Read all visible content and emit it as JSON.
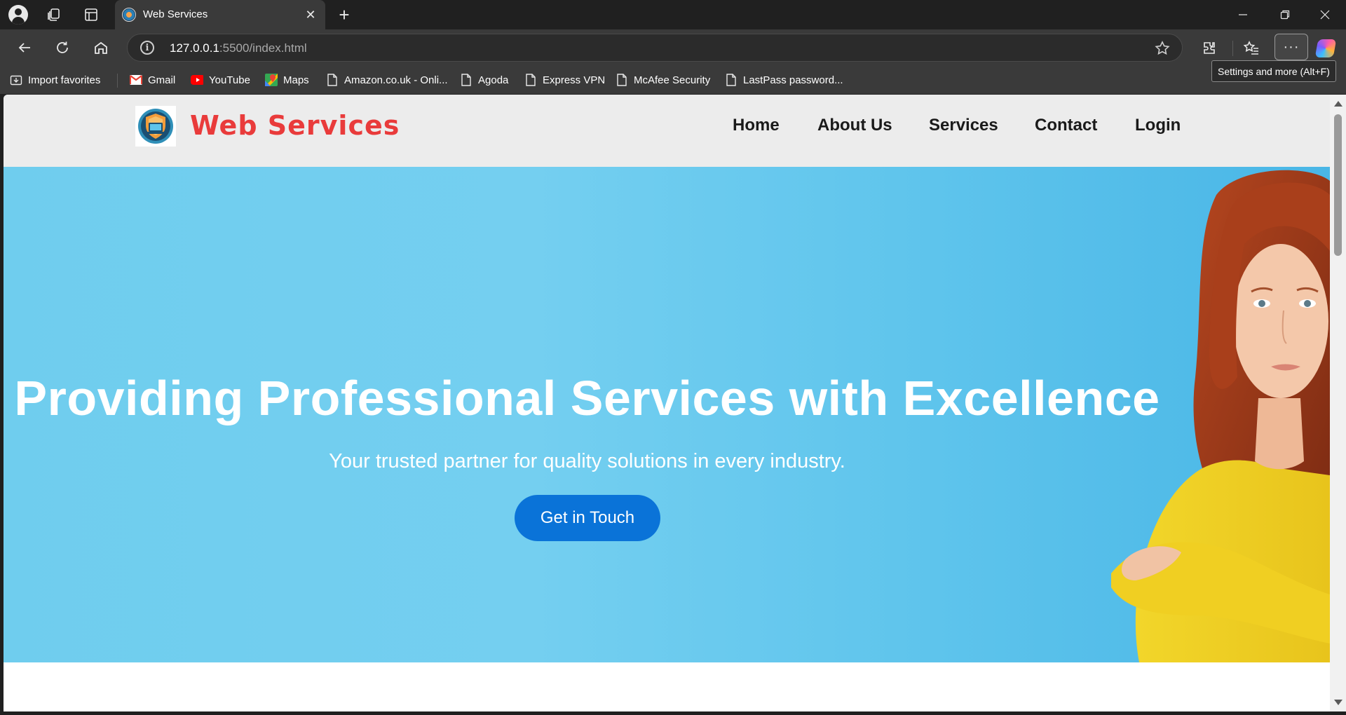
{
  "browser": {
    "tab": {
      "title": "Web Services"
    },
    "address": {
      "host": "127.0.0.1",
      "rest": ":5500/index.html"
    },
    "tooltip": "Settings and more (Alt+F)",
    "favorites": [
      {
        "label": "Import favorites",
        "icon": "import-icon"
      },
      {
        "label": "Gmail",
        "icon": "gmail-icon"
      },
      {
        "label": "YouTube",
        "icon": "youtube-icon"
      },
      {
        "label": "Maps",
        "icon": "maps-icon"
      },
      {
        "label": "Amazon.co.uk - Onli...",
        "icon": "page-icon"
      },
      {
        "label": "Agoda",
        "icon": "page-icon"
      },
      {
        "label": "Express VPN",
        "icon": "page-icon"
      },
      {
        "label": "McAfee Security",
        "icon": "page-icon"
      },
      {
        "label": "LastPass password...",
        "icon": "page-icon"
      }
    ]
  },
  "site": {
    "brand": "Web Services",
    "nav": [
      "Home",
      "About Us",
      "Services",
      "Contact",
      "Login"
    ],
    "hero": {
      "title": "Providing Professional Services with Excellence",
      "subtitle": "Your trusted partner for quality solutions in every industry.",
      "cta": "Get in Touch"
    }
  },
  "colors": {
    "brand_red": "#e93b3b",
    "hero_blue": "#6fcdee",
    "cta_blue": "#0a73d8",
    "header_gray": "#ececec"
  }
}
